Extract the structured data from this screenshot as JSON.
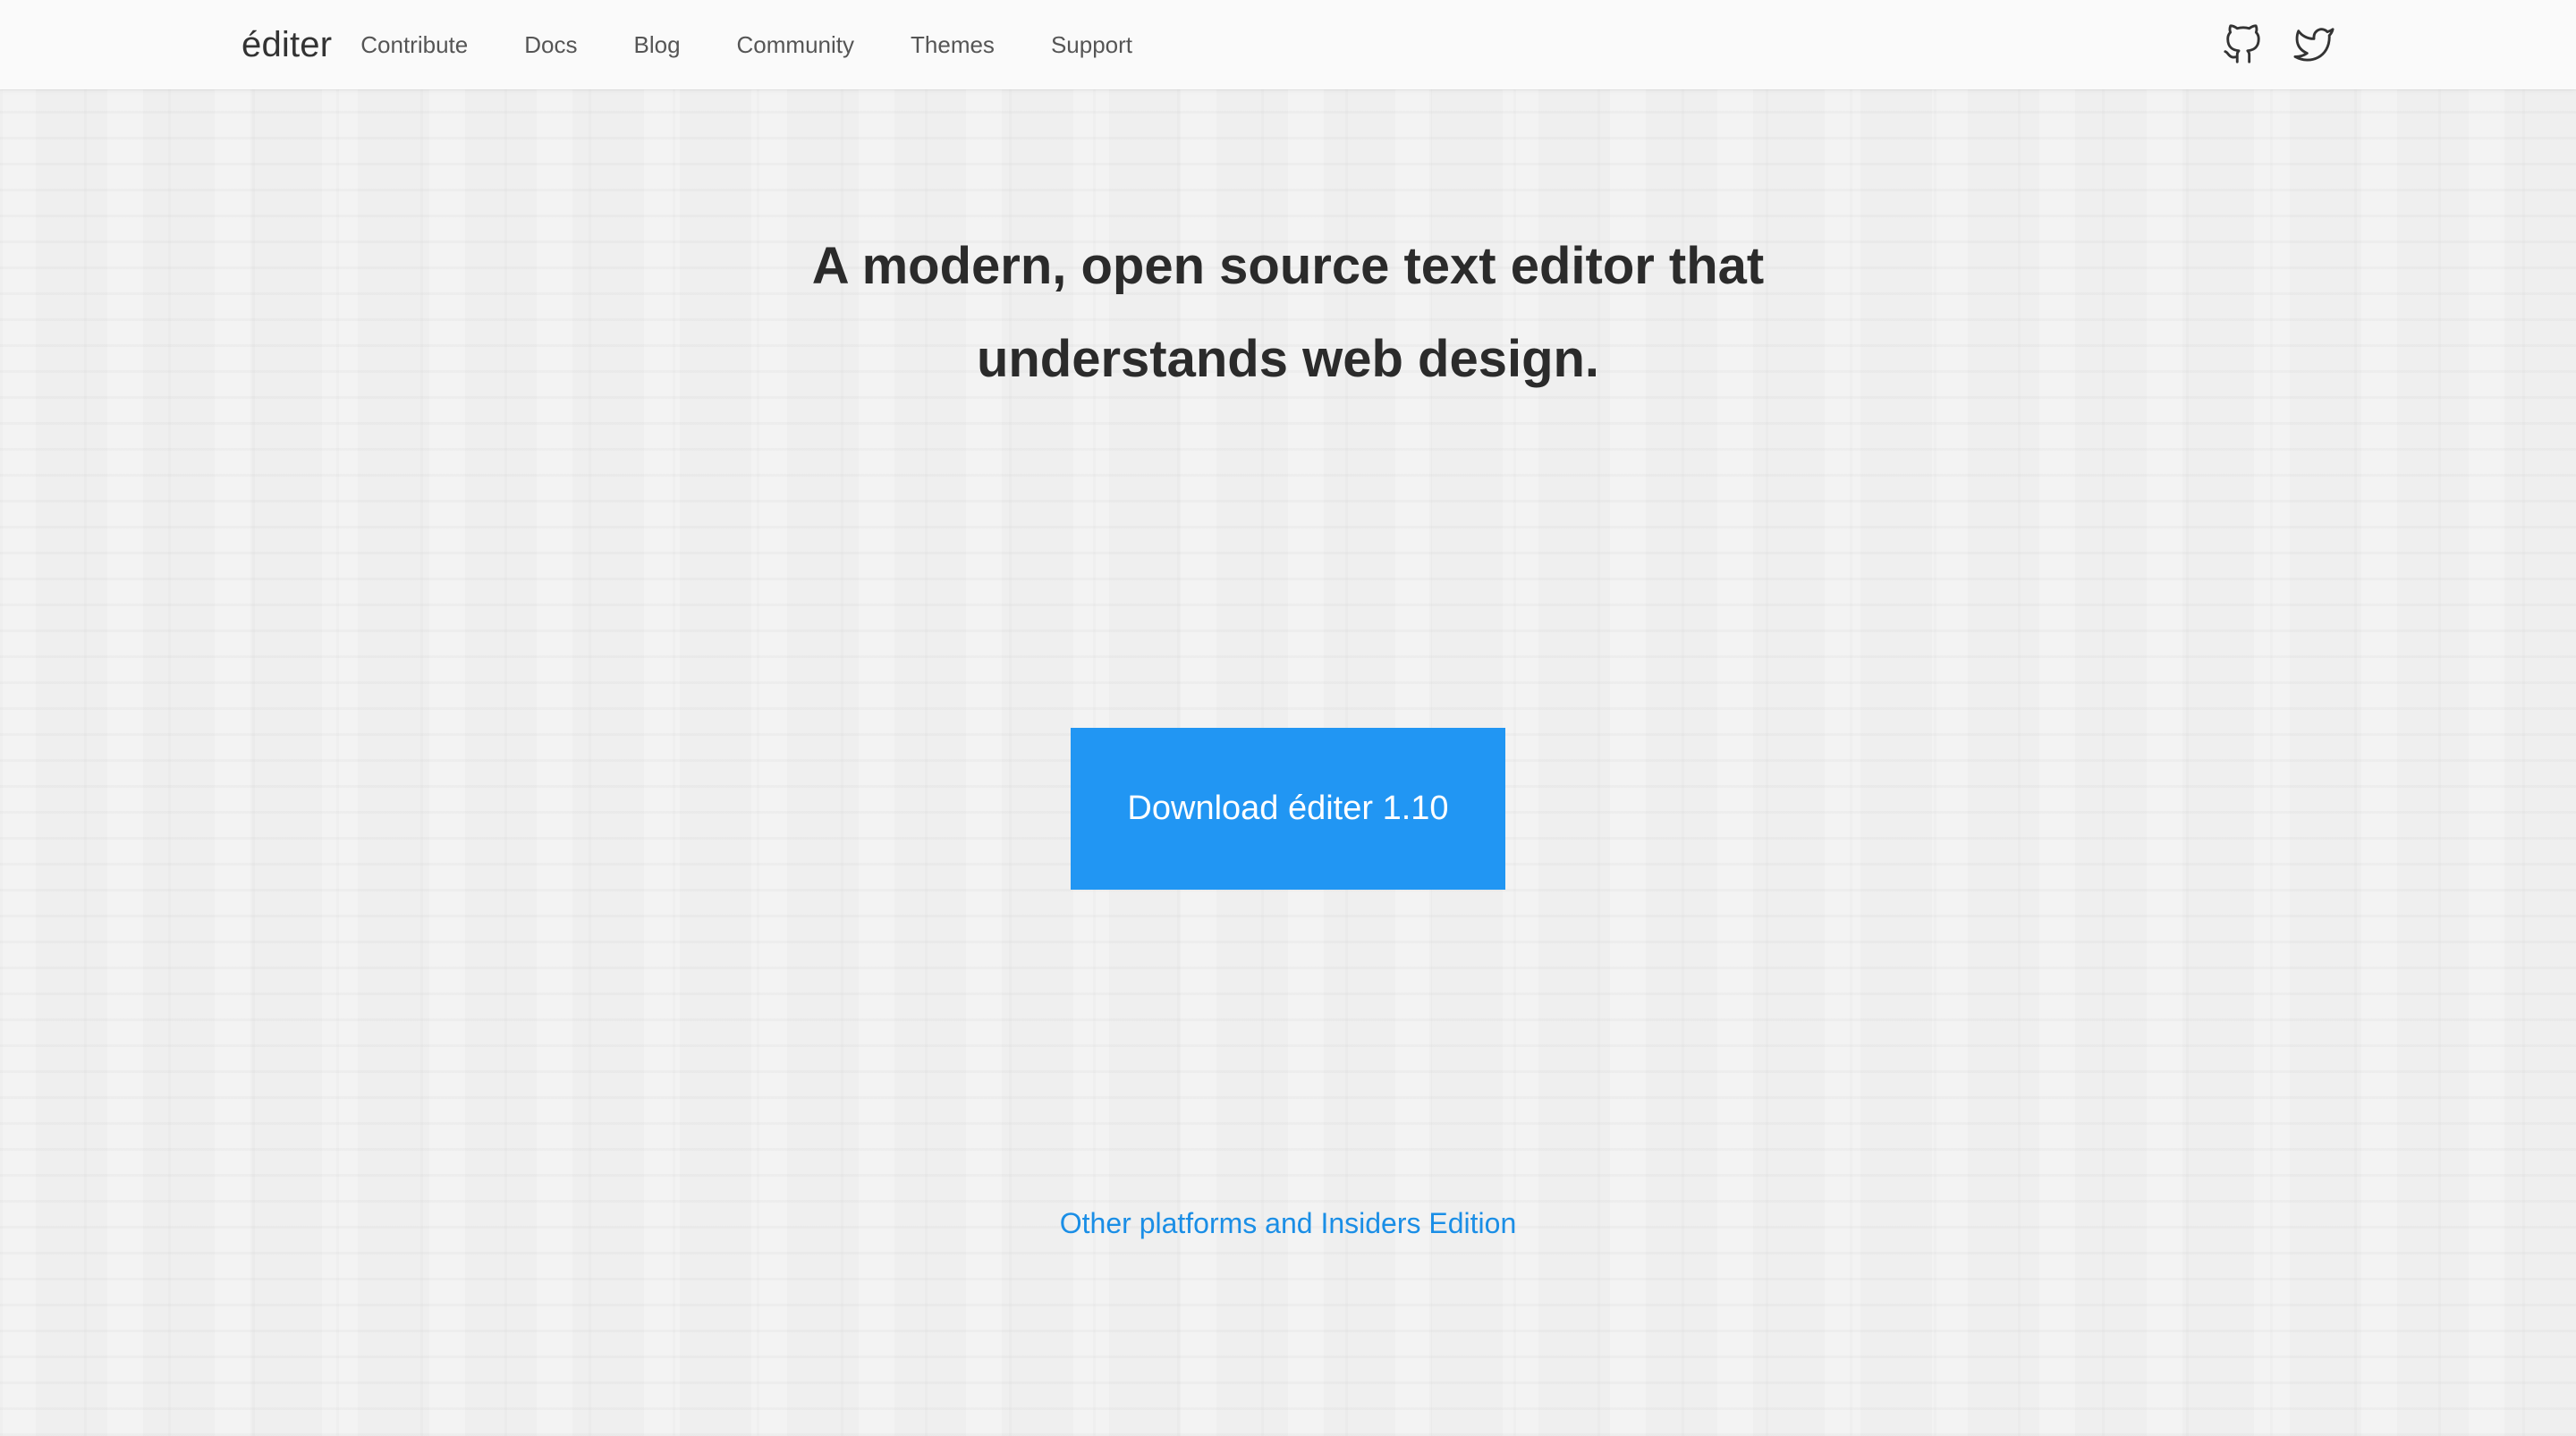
{
  "header": {
    "brand": "éditer",
    "nav": [
      {
        "label": "Contribute"
      },
      {
        "label": "Docs"
      },
      {
        "label": "Blog"
      },
      {
        "label": "Community"
      },
      {
        "label": "Themes"
      },
      {
        "label": "Support"
      }
    ],
    "icons": [
      "github-icon",
      "twitter-icon"
    ]
  },
  "hero": {
    "title_line1": "A modern, open source text editor that",
    "title_line2": "understands web design."
  },
  "download": {
    "button_label": "Download éditer 1.10",
    "other_link": "Other platforms and Insiders Edition"
  },
  "colors": {
    "accent": "#2196f3",
    "link": "#1a8ee6",
    "background": "#efefef",
    "navbar": "#fafafa"
  }
}
